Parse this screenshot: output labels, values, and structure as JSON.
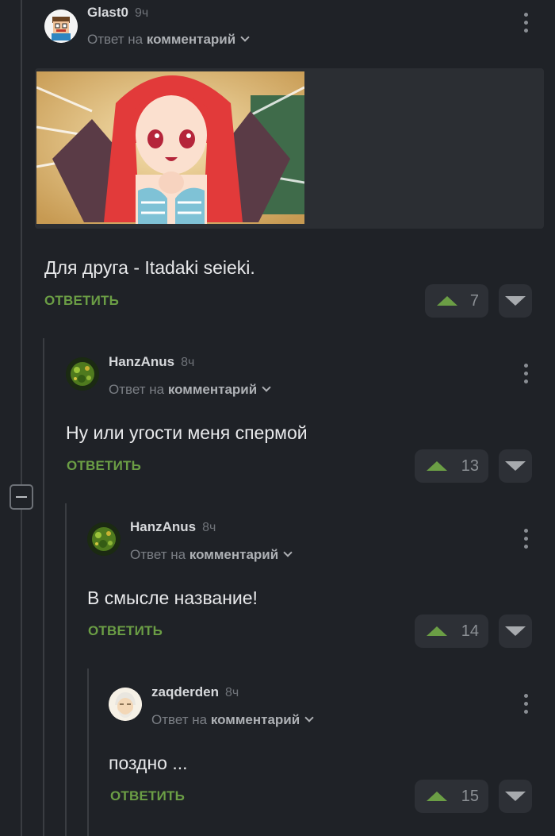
{
  "comments": [
    {
      "username": "Glast0",
      "time": "9ч",
      "reply_prefix": "Ответ на",
      "reply_target": "комментарий",
      "text": "Для друга - Itadaki seieki.",
      "reply_label": "ОТВЕТИТЬ",
      "votes": "7",
      "avatar": "cartoon-face-avatar",
      "has_image": true
    },
    {
      "username": "HanzAnus",
      "time": "8ч",
      "reply_prefix": "Ответ на",
      "reply_target": "комментарий",
      "text": "Ну или угости меня спермой",
      "reply_label": "ОТВЕТИТЬ",
      "votes": "13",
      "avatar": "green-creature-avatar"
    },
    {
      "username": "HanzAnus",
      "time": "8ч",
      "reply_prefix": "Ответ на",
      "reply_target": "комментарий",
      "text": "В смысле название!",
      "reply_label": "ОТВЕТИТЬ",
      "votes": "14",
      "avatar": "green-creature-avatar"
    },
    {
      "username": "zaqderden",
      "time": "8ч",
      "reply_prefix": "Ответ на",
      "reply_target": "комментарий",
      "text": "поздно ...",
      "reply_label": "ОТВЕТИТЬ",
      "votes": "15",
      "avatar": "old-man-avatar"
    }
  ],
  "colors": {
    "background": "#1f2227",
    "accent_green": "#6b9e45",
    "button_bg": "#2d3036"
  },
  "icons": [
    "upvote-icon",
    "downvote-icon",
    "more-options-icon",
    "chevron-down-icon",
    "collapse-icon"
  ]
}
